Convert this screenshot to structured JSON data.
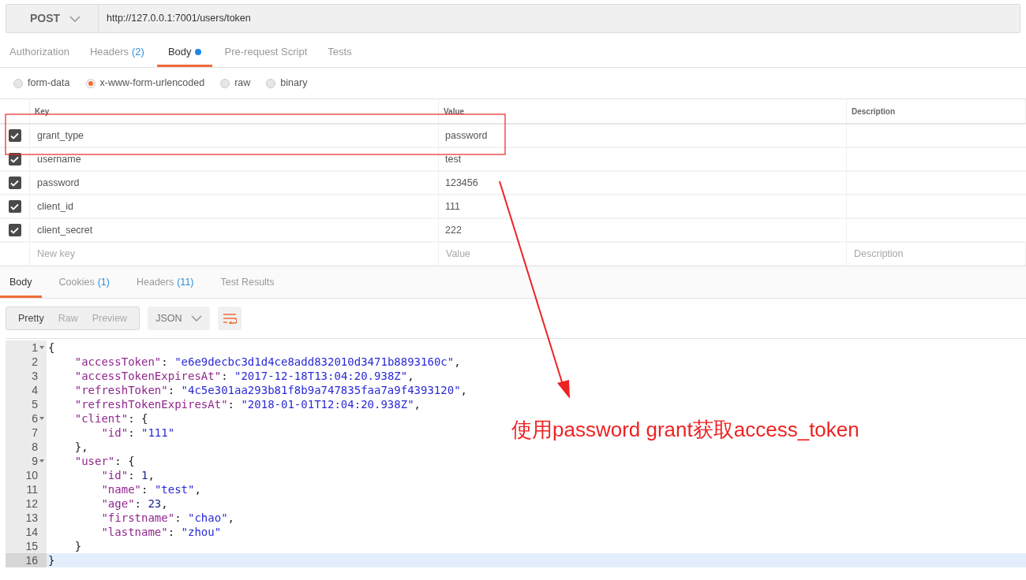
{
  "request": {
    "method": "POST",
    "url": "http://127.0.0.1:7001/users/token"
  },
  "request_tabs": [
    {
      "label": "Authorization",
      "selected": false,
      "modified": false
    },
    {
      "label": "Headers",
      "count": "(2)",
      "selected": false,
      "modified": false
    },
    {
      "label": "Body",
      "selected": true,
      "modified": true
    },
    {
      "label": "Pre-request Script",
      "selected": false,
      "modified": false
    },
    {
      "label": "Tests",
      "selected": false,
      "modified": false
    }
  ],
  "body_types": [
    {
      "label": "form-data",
      "selected": false
    },
    {
      "label": "x-www-form-urlencoded",
      "selected": true
    },
    {
      "label": "raw",
      "selected": false
    },
    {
      "label": "binary",
      "selected": false
    }
  ],
  "params": {
    "columns": [
      "Key",
      "Value",
      "Description"
    ],
    "rows": [
      {
        "key": "grant_type",
        "value": "password",
        "checked": true
      },
      {
        "key": "username",
        "value": "test",
        "checked": true
      },
      {
        "key": "password",
        "value": "123456",
        "checked": true
      },
      {
        "key": "client_id",
        "value": "111",
        "checked": true
      },
      {
        "key": "client_secret",
        "value": "222",
        "checked": true
      }
    ],
    "new_row": [
      {
        "placeholder": "New key"
      },
      {
        "placeholder": "Value"
      },
      {
        "placeholder": "Description"
      }
    ]
  },
  "response_tabs": [
    {
      "label": "Body",
      "selected": true
    },
    {
      "label": "Cookies",
      "count": "(1)",
      "selected": false
    },
    {
      "label": "Headers",
      "count": "(11)",
      "selected": false
    },
    {
      "label": "Test Results",
      "selected": false
    }
  ],
  "view_modes": [
    {
      "label": "Pretty",
      "selected": true
    },
    {
      "label": "Raw",
      "selected": false
    },
    {
      "label": "Preview",
      "selected": false
    }
  ],
  "format": "JSON",
  "code": [
    {
      "number": "1",
      "foldable": true,
      "current": false,
      "tokens": [
        {
          "kind": "punct",
          "text": "{"
        }
      ]
    },
    {
      "number": "2",
      "foldable": false,
      "current": false,
      "tokens": [
        {
          "kind": "key",
          "text": "    \"accessToken\""
        },
        {
          "kind": "punct",
          "text": ": "
        },
        {
          "kind": "string",
          "text": "\"e6e9decbc3d1d4ce8add832010d3471b8893160c\""
        },
        {
          "kind": "punct",
          "text": ","
        }
      ]
    },
    {
      "number": "3",
      "foldable": false,
      "current": false,
      "tokens": [
        {
          "kind": "key",
          "text": "    \"accessTokenExpiresAt\""
        },
        {
          "kind": "punct",
          "text": ": "
        },
        {
          "kind": "string",
          "text": "\"2017-12-18T13:04:20.938Z\""
        },
        {
          "kind": "punct",
          "text": ","
        }
      ]
    },
    {
      "number": "4",
      "foldable": false,
      "current": false,
      "tokens": [
        {
          "kind": "key",
          "text": "    \"refreshToken\""
        },
        {
          "kind": "punct",
          "text": ": "
        },
        {
          "kind": "string",
          "text": "\"4c5e301aa293b81f8b9a747835faa7a9f4393120\""
        },
        {
          "kind": "punct",
          "text": ","
        }
      ]
    },
    {
      "number": "5",
      "foldable": false,
      "current": false,
      "tokens": [
        {
          "kind": "key",
          "text": "    \"refreshTokenExpiresAt\""
        },
        {
          "kind": "punct",
          "text": ": "
        },
        {
          "kind": "string",
          "text": "\"2018-01-01T12:04:20.938Z\""
        },
        {
          "kind": "punct",
          "text": ","
        }
      ]
    },
    {
      "number": "6",
      "foldable": true,
      "current": false,
      "tokens": [
        {
          "kind": "key",
          "text": "    \"client\""
        },
        {
          "kind": "punct",
          "text": ": {"
        }
      ]
    },
    {
      "number": "7",
      "foldable": false,
      "current": false,
      "tokens": [
        {
          "kind": "key",
          "text": "        \"id\""
        },
        {
          "kind": "punct",
          "text": ": "
        },
        {
          "kind": "string",
          "text": "\"111\""
        }
      ]
    },
    {
      "number": "8",
      "foldable": false,
      "current": false,
      "tokens": [
        {
          "kind": "punct",
          "text": "    },"
        }
      ]
    },
    {
      "number": "9",
      "foldable": true,
      "current": false,
      "tokens": [
        {
          "kind": "key",
          "text": "    \"user\""
        },
        {
          "kind": "punct",
          "text": ": {"
        }
      ]
    },
    {
      "number": "10",
      "foldable": false,
      "current": false,
      "tokens": [
        {
          "kind": "key",
          "text": "        \"id\""
        },
        {
          "kind": "punct",
          "text": ": "
        },
        {
          "kind": "number",
          "text": "1"
        },
        {
          "kind": "punct",
          "text": ","
        }
      ]
    },
    {
      "number": "11",
      "foldable": false,
      "current": false,
      "tokens": [
        {
          "kind": "key",
          "text": "        \"name\""
        },
        {
          "kind": "punct",
          "text": ": "
        },
        {
          "kind": "string",
          "text": "\"test\""
        },
        {
          "kind": "punct",
          "text": ","
        }
      ]
    },
    {
      "number": "12",
      "foldable": false,
      "current": false,
      "tokens": [
        {
          "kind": "key",
          "text": "        \"age\""
        },
        {
          "kind": "punct",
          "text": ": "
        },
        {
          "kind": "number",
          "text": "23"
        },
        {
          "kind": "punct",
          "text": ","
        }
      ]
    },
    {
      "number": "13",
      "foldable": false,
      "current": false,
      "tokens": [
        {
          "kind": "key",
          "text": "        \"firstname\""
        },
        {
          "kind": "punct",
          "text": ": "
        },
        {
          "kind": "string",
          "text": "\"chao\""
        },
        {
          "kind": "punct",
          "text": ","
        }
      ]
    },
    {
      "number": "14",
      "foldable": false,
      "current": false,
      "tokens": [
        {
          "kind": "key",
          "text": "        \"lastname\""
        },
        {
          "kind": "punct",
          "text": ": "
        },
        {
          "kind": "string",
          "text": "\"zhou\""
        }
      ]
    },
    {
      "number": "15",
      "foldable": false,
      "current": false,
      "tokens": [
        {
          "kind": "punct",
          "text": "    }"
        }
      ]
    },
    {
      "number": "16",
      "foldable": false,
      "current": true,
      "tokens": [
        {
          "kind": "punct",
          "text": "}"
        }
      ]
    }
  ],
  "annotation": {
    "text": "使用password grant获取access_token"
  }
}
